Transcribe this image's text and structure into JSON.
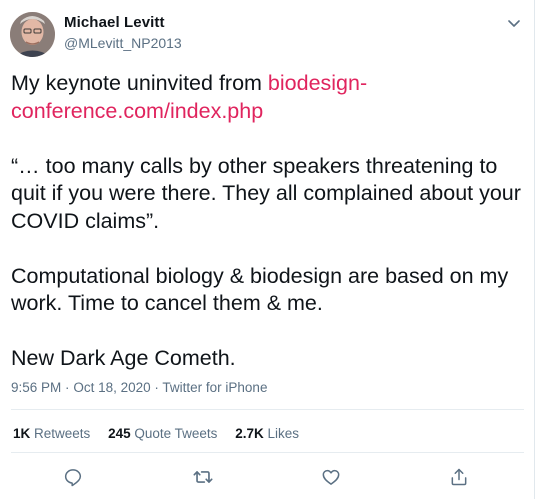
{
  "tweet": {
    "author_name": "Michael Levitt",
    "author_handle": "@MLevitt_NP2013",
    "line1_text": "My keynote uninvited from ",
    "line1_link": "biodesign-conference.com/index.php",
    "quote_text": "“… too many calls by other speakers threatening to quit if you were there. They all complained about your COVID claims”.",
    "paragraph2": "Computational biology & biodesign are based on my work. Time to cancel them & me.",
    "paragraph3": "New Dark Age Cometh.",
    "time": "9:56 PM",
    "date": "Oct 18, 2020",
    "source": "Twitter for iPhone",
    "separator": "·"
  },
  "stats": {
    "retweets_count": "1K",
    "retweets_label": "Retweets",
    "quotes_count": "245",
    "quotes_label": "Quote Tweets",
    "likes_count": "2.7K",
    "likes_label": "Likes"
  },
  "colors": {
    "link": "#e0245e",
    "secondary_text": "#5b7083",
    "icon": "#5b7083"
  },
  "icons": [
    "chevron-down-icon",
    "reply-icon",
    "retweet-icon",
    "like-icon",
    "share-icon"
  ]
}
